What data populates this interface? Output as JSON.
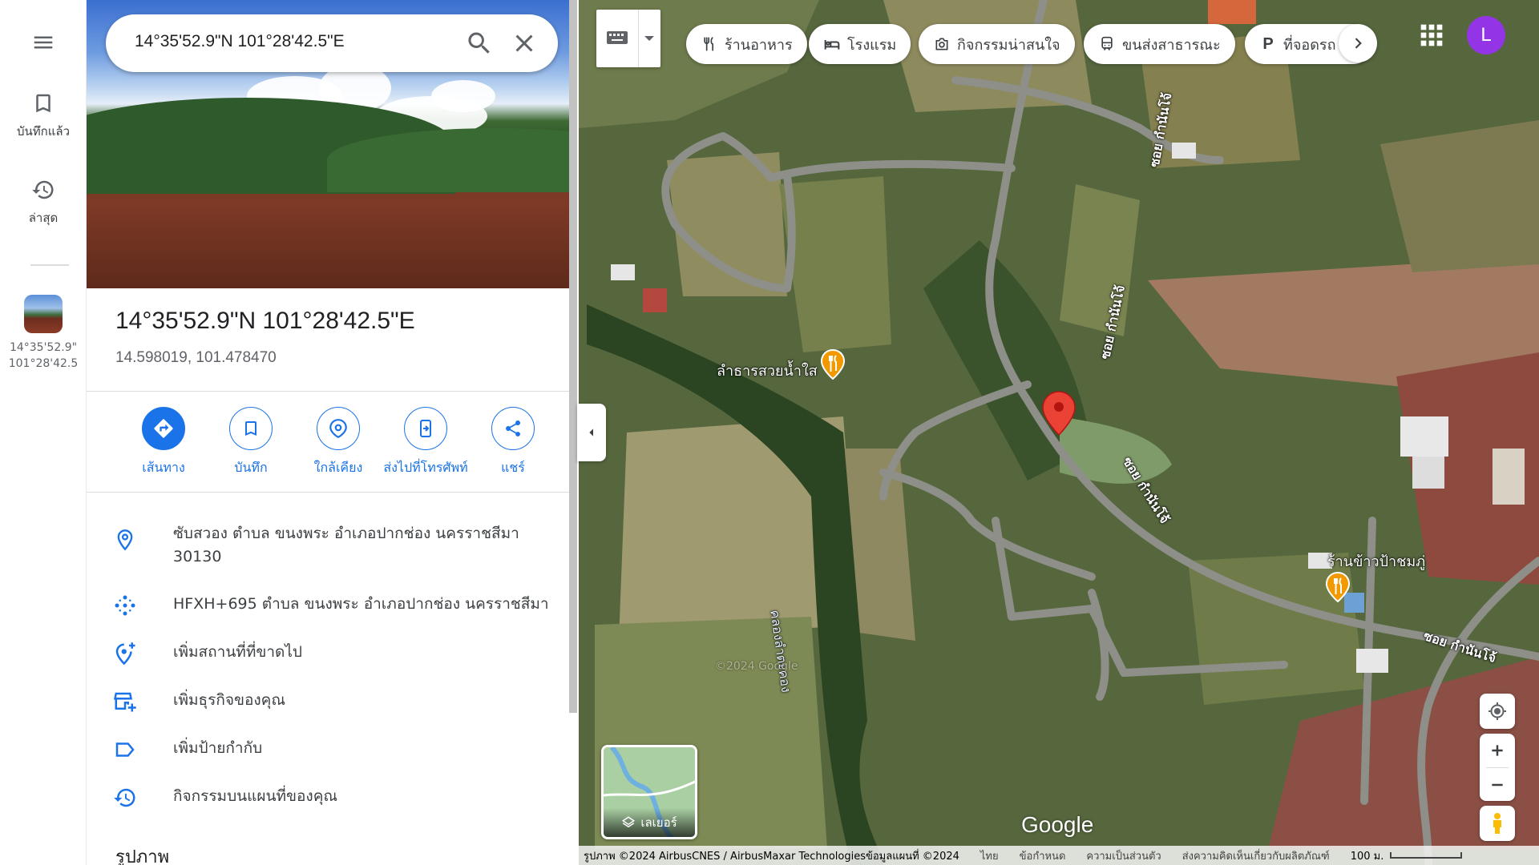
{
  "search": {
    "query": "14°35'52.9\"N 101°28'42.5\"E"
  },
  "rail": {
    "saved_label": "บันทึกแล้ว",
    "recent_label": "ล่าสุด",
    "recent_item_line1": "14°35'52.9\"",
    "recent_item_line2": "101°28'42.5"
  },
  "place": {
    "title": "14°35'52.9\"N 101°28'42.5\"E",
    "coords": "14.598019, 101.478470"
  },
  "actions": [
    {
      "label": "เส้นทาง",
      "icon": "directions-icon"
    },
    {
      "label": "บันทึก",
      "icon": "bookmark-icon"
    },
    {
      "label": "ใกล้เคียง",
      "icon": "nearby-icon"
    },
    {
      "label": "ส่งไปที่โทรศัพท์",
      "icon": "send-to-phone-icon"
    },
    {
      "label": "แชร์",
      "icon": "share-icon"
    }
  ],
  "info": {
    "address_line1": "ซับสวอง ตำบล ขนงพระ อำเภอปากช่อง นครราชสีมา",
    "address_line2": "30130",
    "plus_code": "HFXH+695 ตำบล ขนงพระ อำเภอปากช่อง นครราชสีมา",
    "add_missing_place": "เพิ่มสถานที่ที่ขาดไป",
    "add_business": "เพิ่มธุรกิจของคุณ",
    "add_label": "เพิ่มป้ายกำกับ",
    "map_activity": "กิจกรรมบนแผนที่ของคุณ",
    "photos_title": "รูปภาพ"
  },
  "chips": [
    {
      "label": "ร้านอาหาร",
      "icon": "restaurant-icon"
    },
    {
      "label": "โรงแรม",
      "icon": "hotel-icon"
    },
    {
      "label": "กิจกรรมน่าสนใจ",
      "icon": "camera-icon"
    },
    {
      "label": "ขนส่งสาธารณะ",
      "icon": "transit-icon"
    },
    {
      "label": "ที่จอดรถ",
      "icon": "parking-icon"
    }
  ],
  "user": {
    "avatar_letter": "L"
  },
  "map": {
    "poi_1": "ลำธารสวยน้ำใส",
    "poi_2": "ร้านข้าวป้าชมภู่",
    "road_1": "ซอย กำนันโจ้",
    "road_2": "ซอย กำนันโจ้",
    "road_3": "ซอย กำนันโจ้",
    "road_4": "ซอย กำนันโจ้",
    "canal": "คลองลำตะคอง",
    "layers_label": "เลเยอร์",
    "google_logo": "Google",
    "watermark": "©2024 Google"
  },
  "footer": {
    "imagery": "รูปภาพ ©2024 AirbusCNES / AirbusMaxar Technologiesข้อมูลแผนที่ ©2024",
    "language": "ไทย",
    "terms": "ข้อกำหนด",
    "privacy": "ความเป็นส่วนตัว",
    "feedback": "ส่งความคิดเห็นเกี่ยวกับผลิตภัณฑ์",
    "scale": "100 ม."
  },
  "colors": {
    "accent": "#1a73e8",
    "pin": "#ea4335",
    "poi": "#f29900",
    "avatar": "#9334e6"
  }
}
